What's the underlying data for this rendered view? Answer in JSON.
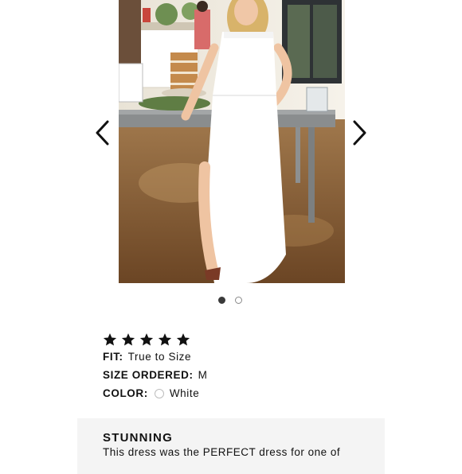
{
  "carousel": {
    "prev_icon": "chevron-left-icon",
    "next_icon": "chevron-right-icon",
    "photo_alt": "Customer photo",
    "pagination": {
      "total": 2,
      "active_index": 0
    }
  },
  "review": {
    "rating": 5,
    "max_rating": 5,
    "star_icon": "star-icon",
    "fit_label": "FIT:",
    "fit_value": "True to Size",
    "size_label": "SIZE ORDERED:",
    "size_value": "M",
    "color_label": "COLOR:",
    "color_value": "White",
    "color_swatch": "#ffffff",
    "title": "STUNNING",
    "body": "This dress was the PERFECT dress for one of"
  },
  "colors": {
    "text": "#111111",
    "review_bg": "#f4f4f4",
    "dot_active": "#3a3a3a"
  }
}
